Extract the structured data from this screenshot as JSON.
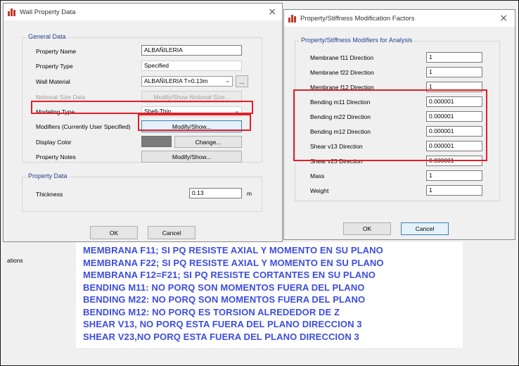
{
  "background": {
    "side_text": "ations"
  },
  "wall_dialog": {
    "title": "Wall Property Data",
    "close_glyph": "×",
    "general_group": "General Data",
    "property_name_label": "Property Name",
    "property_name_value": "ALBAÑILERIA",
    "property_type_label": "Property Type",
    "property_type_value": "Specified",
    "wall_material_label": "Wall Material",
    "wall_material_value": "ALBAÑILERIA T=0.13m",
    "more_button": "...",
    "notional_label": "Notional Size Data",
    "notional_button": "Modify/Show Notional Size...",
    "modeling_type_label": "Modeling Type",
    "modeling_type_value": "Shell-Thin",
    "modifiers_label": "Modifiers (Currently User Specified)",
    "modifiers_button": "Modify/Show...",
    "display_color_label": "Display Color",
    "display_color_value": "#7b7b7b",
    "change_button": "Change...",
    "notes_label": "Property Notes",
    "notes_button": "Modify/Show...",
    "property_group": "Property Data",
    "thickness_label": "Thickness",
    "thickness_value": "0.13",
    "thickness_unit": "m",
    "ok_button": "OK",
    "cancel_button": "Cancel"
  },
  "modifiers_dialog": {
    "title": "Property/Stiffness Modification Factors",
    "close_glyph": "×",
    "group_label": "Property/Stiffness Modifiers for Analysis",
    "rows": [
      {
        "label": "Membrane f11 Direction",
        "value": "1"
      },
      {
        "label": "Membrane f22 Direction",
        "value": "1"
      },
      {
        "label": "Membrane f12 Direction",
        "value": "1"
      },
      {
        "label": "Bending m11 Direction",
        "value": "0.000001"
      },
      {
        "label": "Bending m22 Direction",
        "value": "0.000001"
      },
      {
        "label": "Bending m12 Direction",
        "value": "0.000001"
      },
      {
        "label": "Shear v13 Direction",
        "value": "0.000001"
      },
      {
        "label": "Shear v23 Direction",
        "value": "0.000001"
      },
      {
        "label": "Mass",
        "value": "1"
      },
      {
        "label": "Weight",
        "value": "1"
      }
    ],
    "ok_button": "OK",
    "cancel_button": "Cancel"
  },
  "annotation": {
    "color": "#3d4de0",
    "lines": [
      "MEMBRANA F11; SI PQ RESISTE AXIAL Y MOMENTO EN SU PLANO",
      "MEMBRANA F22; SI PQ RESISTE AXIAL Y MOMENTO EN SU PLANO",
      "MEMBRANA F12=F21; SI PQ RESISTE CORTANTES EN SU PLANO",
      "BENDING M11: NO PORQ SON MOMENTOS FUERA DEL PLANO",
      "BENDING M22: NO PORQ SON MOMENTOS FUERA DEL PLANO",
      "BENDING M12: NO PORQ ES TORSION ALREDEDOR DE Z",
      "SHEAR V13, NO PORQ ESTA FUERA DEL PLANO DIRECCION 3",
      "SHEAR V23,NO PORQ ESTA FUERA DEL PLANO DIRECCION 3"
    ]
  },
  "highlight_color": "#e0202a"
}
